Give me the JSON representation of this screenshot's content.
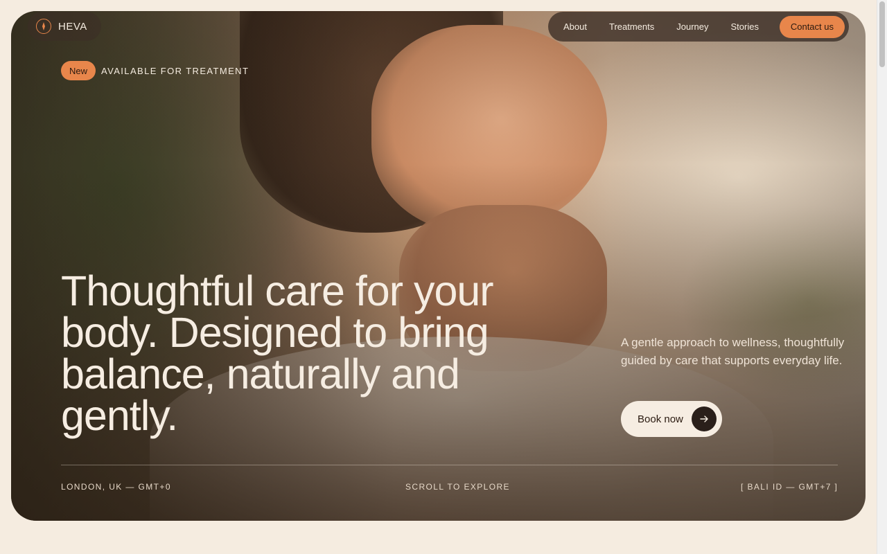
{
  "brand": {
    "name": "HEVA",
    "icon": "compass-icon"
  },
  "nav": {
    "items": [
      "About",
      "Treatments",
      "Journey",
      "Stories"
    ],
    "contact_label": "Contact us"
  },
  "badge": {
    "label": "New",
    "text": "AVAILABLE FOR TREATMENT"
  },
  "hero": {
    "headline": "Thoughtful care for your body. Designed to bring balance, naturally and gently.",
    "lede": "A gentle approach to wellness, thoughtfully guided by care that supports everyday life.",
    "cta_label": "Book now",
    "cta_icon": "arrow-right-icon"
  },
  "footer": {
    "left": "LONDON, UK — GMT+0",
    "center": "SCROLL TO EXPLORE",
    "right": "[ BALI ID — GMT+7 ]"
  },
  "colors": {
    "accent": "#e8864b",
    "page_bg": "#f5ece0",
    "dark": "#2a1f1a"
  }
}
